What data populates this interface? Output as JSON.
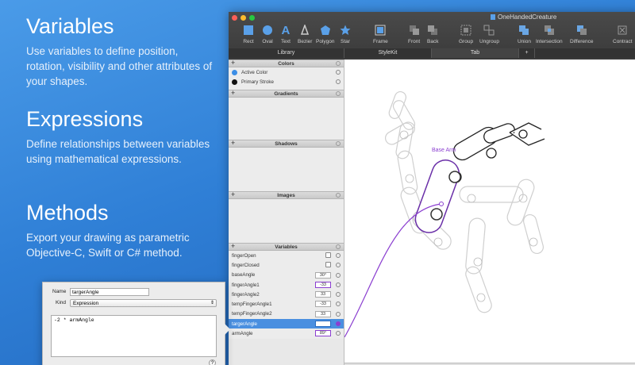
{
  "marketing": [
    {
      "heading": "Variables",
      "body": "Use variables to define position, rotation, visibility and other attributes of your shapes."
    },
    {
      "heading": "Expressions",
      "body": "Define relationships between variables using mathematical expressions."
    },
    {
      "heading": "Methods",
      "body": "Export your drawing as parametric Objective-C, Swift or C# method."
    }
  ],
  "window": {
    "title": "OneHandedCreature",
    "toolbar": [
      "Rect",
      "Oval",
      "Text",
      "Bezier",
      "Polygon",
      "Star",
      "Frame",
      "Front",
      "Back",
      "Group",
      "Ungroup",
      "Union",
      "Intersection",
      "Difference",
      "Contract"
    ],
    "tabs": [
      "Library",
      "StyleKit",
      "Tab",
      "+"
    ]
  },
  "panels": {
    "colors": {
      "title": "Colors",
      "items": [
        {
          "label": "Active Color",
          "color": "#3b8ee6"
        },
        {
          "label": "Primary Stroke",
          "color": "#111111"
        }
      ]
    },
    "gradients": {
      "title": "Gradients"
    },
    "shadows": {
      "title": "Shadows"
    },
    "images": {
      "title": "Images"
    },
    "variables": {
      "title": "Variables",
      "items": [
        {
          "name": "fingerOpen",
          "type": "bool"
        },
        {
          "name": "fingerClosed",
          "type": "bool"
        },
        {
          "name": "baseAngle",
          "value": "30°"
        },
        {
          "name": "fingerAngle1",
          "value": "-33"
        },
        {
          "name": "fingerAngle2",
          "value": "33"
        },
        {
          "name": "tempFingerAngle1",
          "value": "-33"
        },
        {
          "name": "tempFingerAngle2",
          "value": "33"
        },
        {
          "name": "targerAngle",
          "value": "-178"
        },
        {
          "name": "armAngle",
          "value": "89°"
        }
      ]
    }
  },
  "canvas": {
    "annotation": "Base Arm"
  },
  "popover": {
    "name_label": "Name",
    "name_value": "targerAngle",
    "kind_label": "Kind",
    "kind_value": "Expression",
    "expression": "-2 * armAngle",
    "help": "?"
  },
  "colors": {
    "accent": "#4a8fe0",
    "link": "#8b3fd0"
  }
}
